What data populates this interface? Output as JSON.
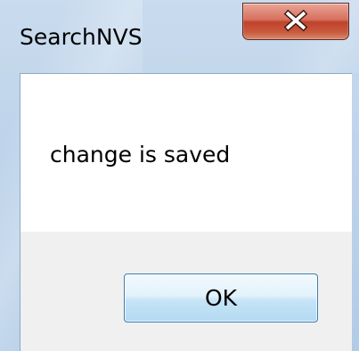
{
  "window": {
    "title": "SearchNVS",
    "close_icon": "close-x-icon"
  },
  "dialog": {
    "message": "change is saved",
    "ok_label": "OK"
  },
  "colors": {
    "frame": "#bdd3ea",
    "close_button": "#c8503a",
    "ok_button_border": "#3c7fb1",
    "button_panel": "#f0f0f0"
  }
}
